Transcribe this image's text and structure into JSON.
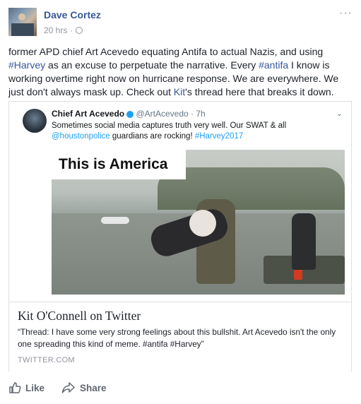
{
  "post": {
    "author": "Dave Cortez",
    "timestamp": "20 hrs",
    "separator": "·",
    "more_label": "···",
    "text_parts": [
      {
        "text": "former APD chief Art Acevedo equating Antifa to actual Nazis, and using ",
        "link": false
      },
      {
        "text": "#Harvey",
        "link": true
      },
      {
        "text": " as an excuse to perpetuate the narrative. Every ",
        "link": false
      },
      {
        "text": "#antifa",
        "link": true
      },
      {
        "text": " I know is working overtime right now on hurricane response. We are everywhere. We just don't always mask up. Check out ",
        "link": false
      },
      {
        "text": "Kit",
        "link": true
      },
      {
        "text": "'s thread here that breaks it down.",
        "link": false
      }
    ]
  },
  "embedded_tweet": {
    "name": "Chief Art Acevedo",
    "handle": "@ArtAcevedo · 7h",
    "chevron": "⌄",
    "text_line1": "Sometimes social media captures truth  very well. Our SWAT & all",
    "mention": "@houstonpolice",
    "text_middle": " guardians are rocking! ",
    "hashtag": "#Harvey2017",
    "image_banner": "This is America"
  },
  "link_preview": {
    "title": "Kit O'Connell on Twitter",
    "description": "“Thread: I have some very strong feelings about this bullshit. Art Acevedo isn't the only one spreading this kind of meme. #antifa #Harvey”",
    "source": "TWITTER.COM"
  },
  "actions": {
    "like_label": "Like",
    "share_label": "Share"
  },
  "colors": {
    "link": "#365899",
    "twitter_blue": "#1da1f2",
    "muted": "#90949c"
  }
}
